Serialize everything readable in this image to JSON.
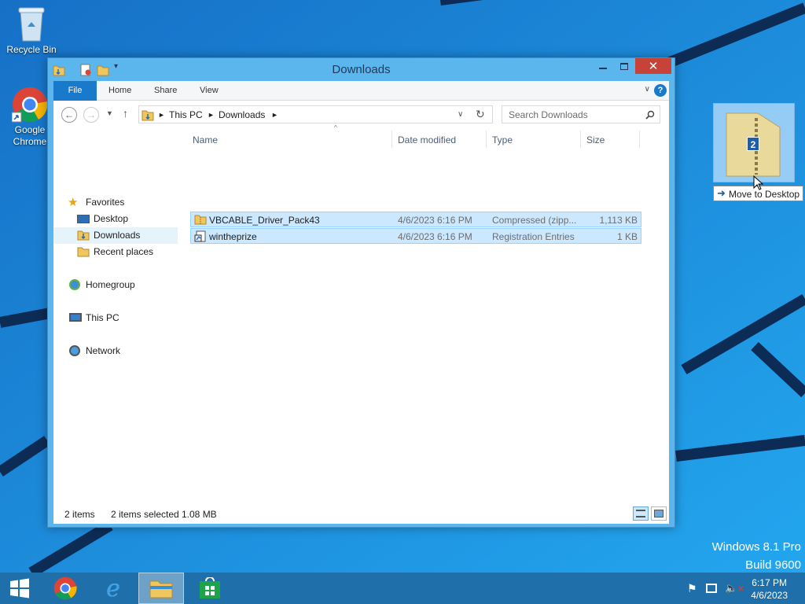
{
  "desktop": {
    "icons": [
      {
        "label": "Recycle Bin",
        "icon": "recycle-bin-icon"
      },
      {
        "label": "Google Chrome",
        "icon": "chrome-icon"
      }
    ],
    "drag_badge": "2",
    "drag_tooltip": "Move to Desktop",
    "watermark": {
      "line1": "Windows 8.1 Pro",
      "line2": "Build 9600"
    }
  },
  "window": {
    "title": "Downloads",
    "ribbon": {
      "tabs": [
        "File",
        "Home",
        "Share",
        "View"
      ],
      "help": "?"
    },
    "address": {
      "crumbs": [
        "This PC",
        "Downloads"
      ]
    },
    "search_placeholder": "Search Downloads",
    "nav": {
      "favorites": "Favorites",
      "desktop": "Desktop",
      "downloads": "Downloads",
      "recent": "Recent places",
      "homegroup": "Homegroup",
      "thispc": "This PC",
      "network": "Network"
    },
    "columns": [
      "Name",
      "Date modified",
      "Type",
      "Size"
    ],
    "files": [
      {
        "name": "VBCABLE_Driver_Pack43",
        "date": "4/6/2023 6:16 PM",
        "type": "Compressed (zipp...",
        "size": "1,113 KB",
        "icon": "zip-folder-icon",
        "selected": true
      },
      {
        "name": "wintheprize",
        "date": "4/6/2023 6:16 PM",
        "type": "Registration Entries",
        "size": "1 KB",
        "icon": "registry-file-icon",
        "selected": true
      }
    ],
    "status": {
      "count": "2 items",
      "selected": "2 items selected",
      "size": "1.08 MB"
    }
  },
  "taskbar": {
    "apps": [
      "start-icon",
      "chrome-icon",
      "internet-explorer-icon",
      "file-explorer-icon",
      "store-icon"
    ],
    "clock": {
      "time": "6:17 PM",
      "date": "4/6/2023"
    }
  },
  "colors": {
    "desktop": "#1b8fe0",
    "window_frame": "#5cb6ee",
    "close": "#c7433a",
    "selection": "#cce8ff",
    "taskbar": "#1f6faa"
  }
}
